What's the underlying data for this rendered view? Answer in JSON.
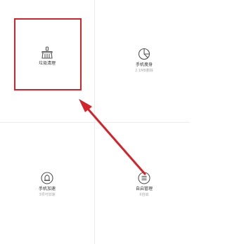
{
  "tiles": {
    "clean": {
      "label": "垃圾清理",
      "sub": ""
    },
    "slim": {
      "label": "手机瘦身",
      "sub": "2.1MB删除"
    },
    "speed": {
      "label": "手机加速",
      "sub": "3项可加速"
    },
    "startup": {
      "label": "自启管理",
      "sub": "6自启"
    }
  },
  "colors": {
    "highlight": "#d4232a",
    "icon": "#555555",
    "divider": "#ececec"
  },
  "icons": {
    "clean": "broom-icon",
    "slim": "pie-chart-icon",
    "speed": "bell-icon",
    "startup": "list-icon"
  }
}
